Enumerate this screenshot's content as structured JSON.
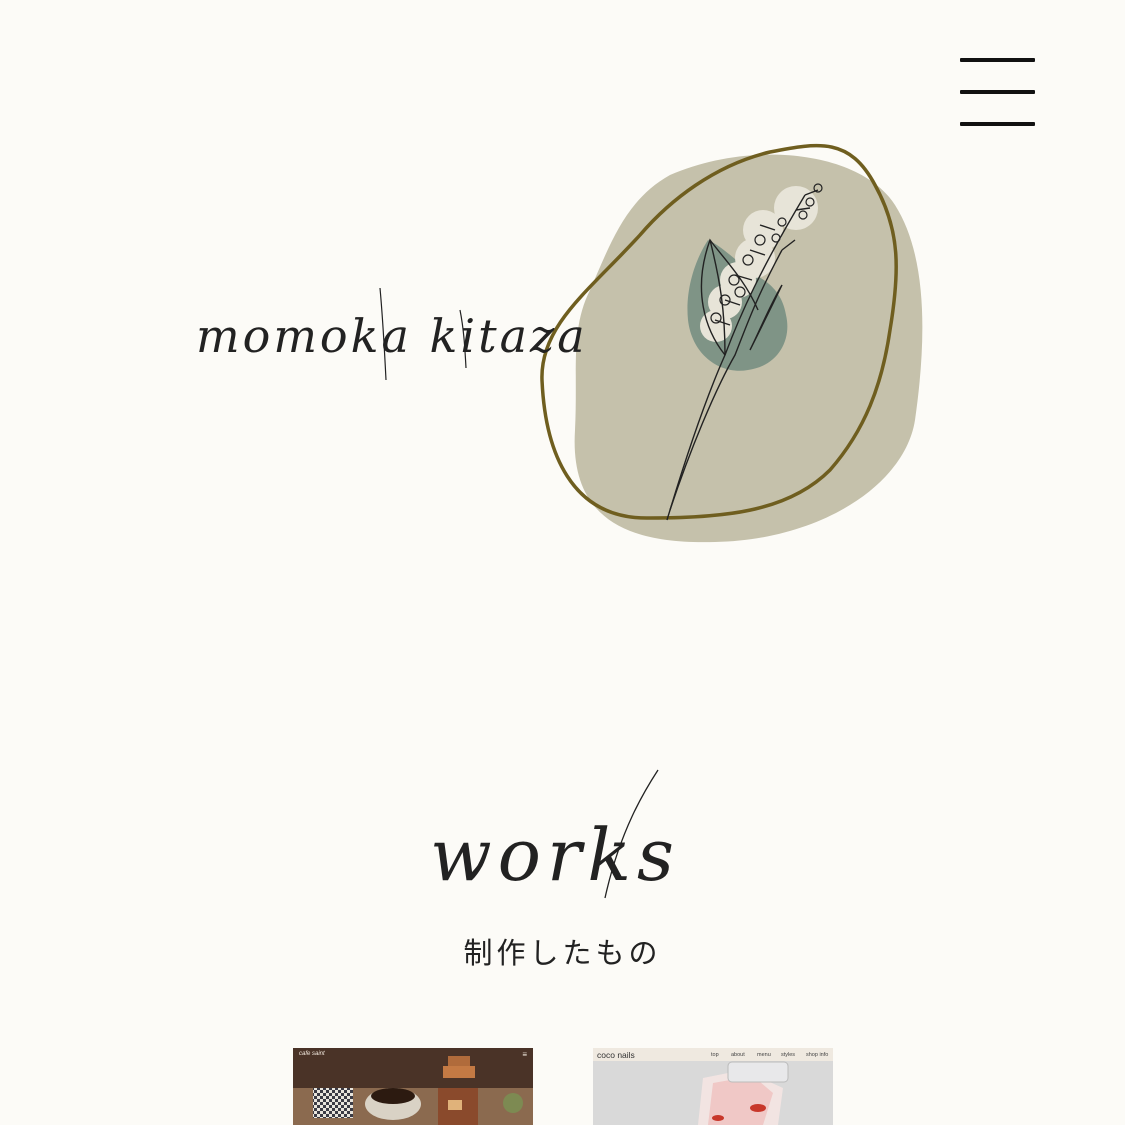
{
  "header": {
    "menu_icon": "hamburger-icon"
  },
  "hero": {
    "name_script": "momoka kitazawa",
    "illustration_icon": "botanical-sprig-illustration",
    "colors": {
      "blob": "#c5c1ab",
      "outline": "#6f5e1f",
      "leaf": "#7f9486",
      "line": "#222222"
    }
  },
  "works": {
    "title_script": "works",
    "subtitle": "制作したもの",
    "cards": [
      {
        "site_name": "cafe saint",
        "menu_icon": "≡"
      },
      {
        "site_name": "coco nails",
        "nav": [
          "top",
          "about",
          "menu",
          "styles",
          "shop info"
        ]
      }
    ]
  }
}
